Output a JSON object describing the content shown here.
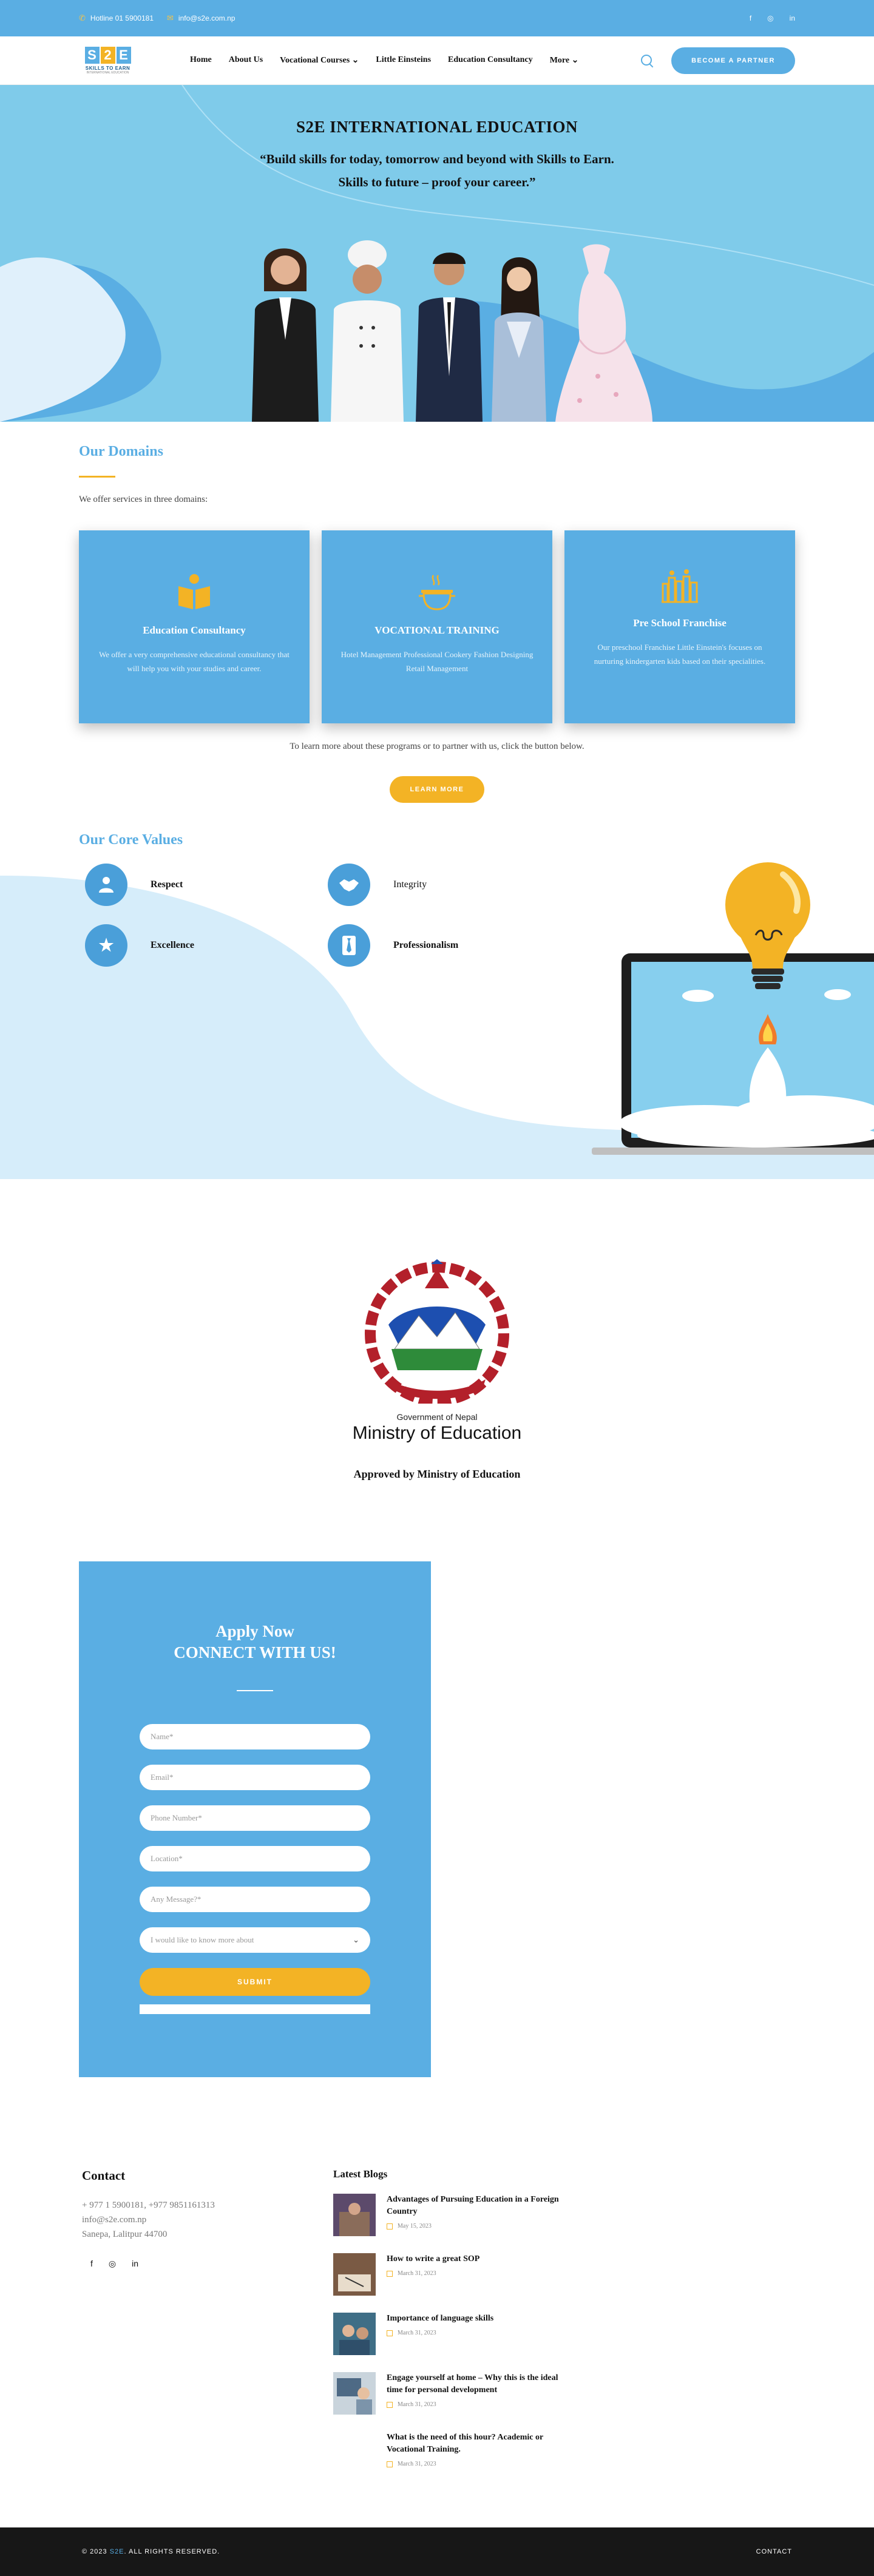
{
  "topbar": {
    "hotline": "Hotline 01 5900181",
    "email": "info@s2e.com.np",
    "socials": [
      "facebook-icon",
      "instagram-icon",
      "linkedin-icon"
    ]
  },
  "logo": {
    "letters": [
      "S",
      "2",
      "E"
    ],
    "tagline": "SKILLS TO EARN",
    "subtag": "INTERNATIONAL EDUCATION"
  },
  "nav": {
    "items": [
      "Home",
      "About Us",
      "Vocational Courses",
      "Little Einsteins",
      "Education Consultancy",
      "More"
    ],
    "cta": "BECOME A PARTNER"
  },
  "hero": {
    "title": "S2E INTERNATIONAL EDUCATION",
    "quote_line1": "“Build skills for today, tomorrow and beyond with Skills to Earn.",
    "quote_line2": "Skills to future – proof your career.”"
  },
  "domains": {
    "title": "Our Domains",
    "intro": "We offer services in three domains:",
    "cards": [
      {
        "icon": "book-icon",
        "title": "Education Consultancy",
        "body": "We offer a very comprehensive educational consultancy that will help you with your studies and career."
      },
      {
        "icon": "cooking-pot-icon",
        "title": "VOCATIONAL TRAINING",
        "body": "Hotel Management Professional Cookery Fashion Designing Retail Management"
      },
      {
        "icon": "preschool-icon",
        "title": "Pre School Franchise",
        "body": "Our preschool Franchise Little Einstein's focuses on nurturing kindergarten kids based on their specialities."
      }
    ],
    "learn_text": "To learn more about these programs or to partner with us, click the button below.",
    "learn_button": "LEARN MORE"
  },
  "values": {
    "title": "Our Core Values",
    "items": [
      {
        "icon": "people-icon",
        "label": "Respect"
      },
      {
        "icon": "handshake-icon",
        "label": "Integrity"
      },
      {
        "icon": "star-icon",
        "label": "Excellence"
      },
      {
        "icon": "tie-icon",
        "label": "Professionalism"
      }
    ]
  },
  "ministry": {
    "sub": "Government of Nepal",
    "name": "Ministry of Education",
    "approved": "Approved by Ministry of Education"
  },
  "form": {
    "title1": "Apply Now",
    "title2": "CONNECT WITH US!",
    "placeholders": [
      "Name*",
      "Email*",
      "Phone Number*",
      "Location*",
      "Any Message?*"
    ],
    "select": "I would like to know more about",
    "submit": "SUBMIT"
  },
  "footer": {
    "contact_title": "Contact",
    "phones": "+ 977 1 5900181, +977 9851161313",
    "email": "info@s2e.com.np",
    "address": "Sanepa, Lalitpur 44700",
    "socials": [
      "facebook-icon",
      "instagram-icon",
      "linkedin-icon"
    ],
    "blogs_title": "Latest Blogs",
    "blogs": [
      {
        "title": "Advantages of Pursuing Education in a Foreign Country",
        "date": "May 15, 2023"
      },
      {
        "title": "How to write a great SOP",
        "date": "March 31, 2023"
      },
      {
        "title": "Importance of language skills",
        "date": "March 31, 2023"
      },
      {
        "title": "Engage yourself at home – Why this is the ideal time for personal development",
        "date": "March 31, 2023"
      },
      {
        "title": "What is the need of this hour? Academic or Vocational Training.",
        "date": "March 31, 2023"
      }
    ]
  },
  "bottom": {
    "copy_prefix": "© 2023",
    "brand": "S2E",
    "copy_suffix": ". ALL RIGHTS RESERVED.",
    "contact": "CONTACT"
  }
}
